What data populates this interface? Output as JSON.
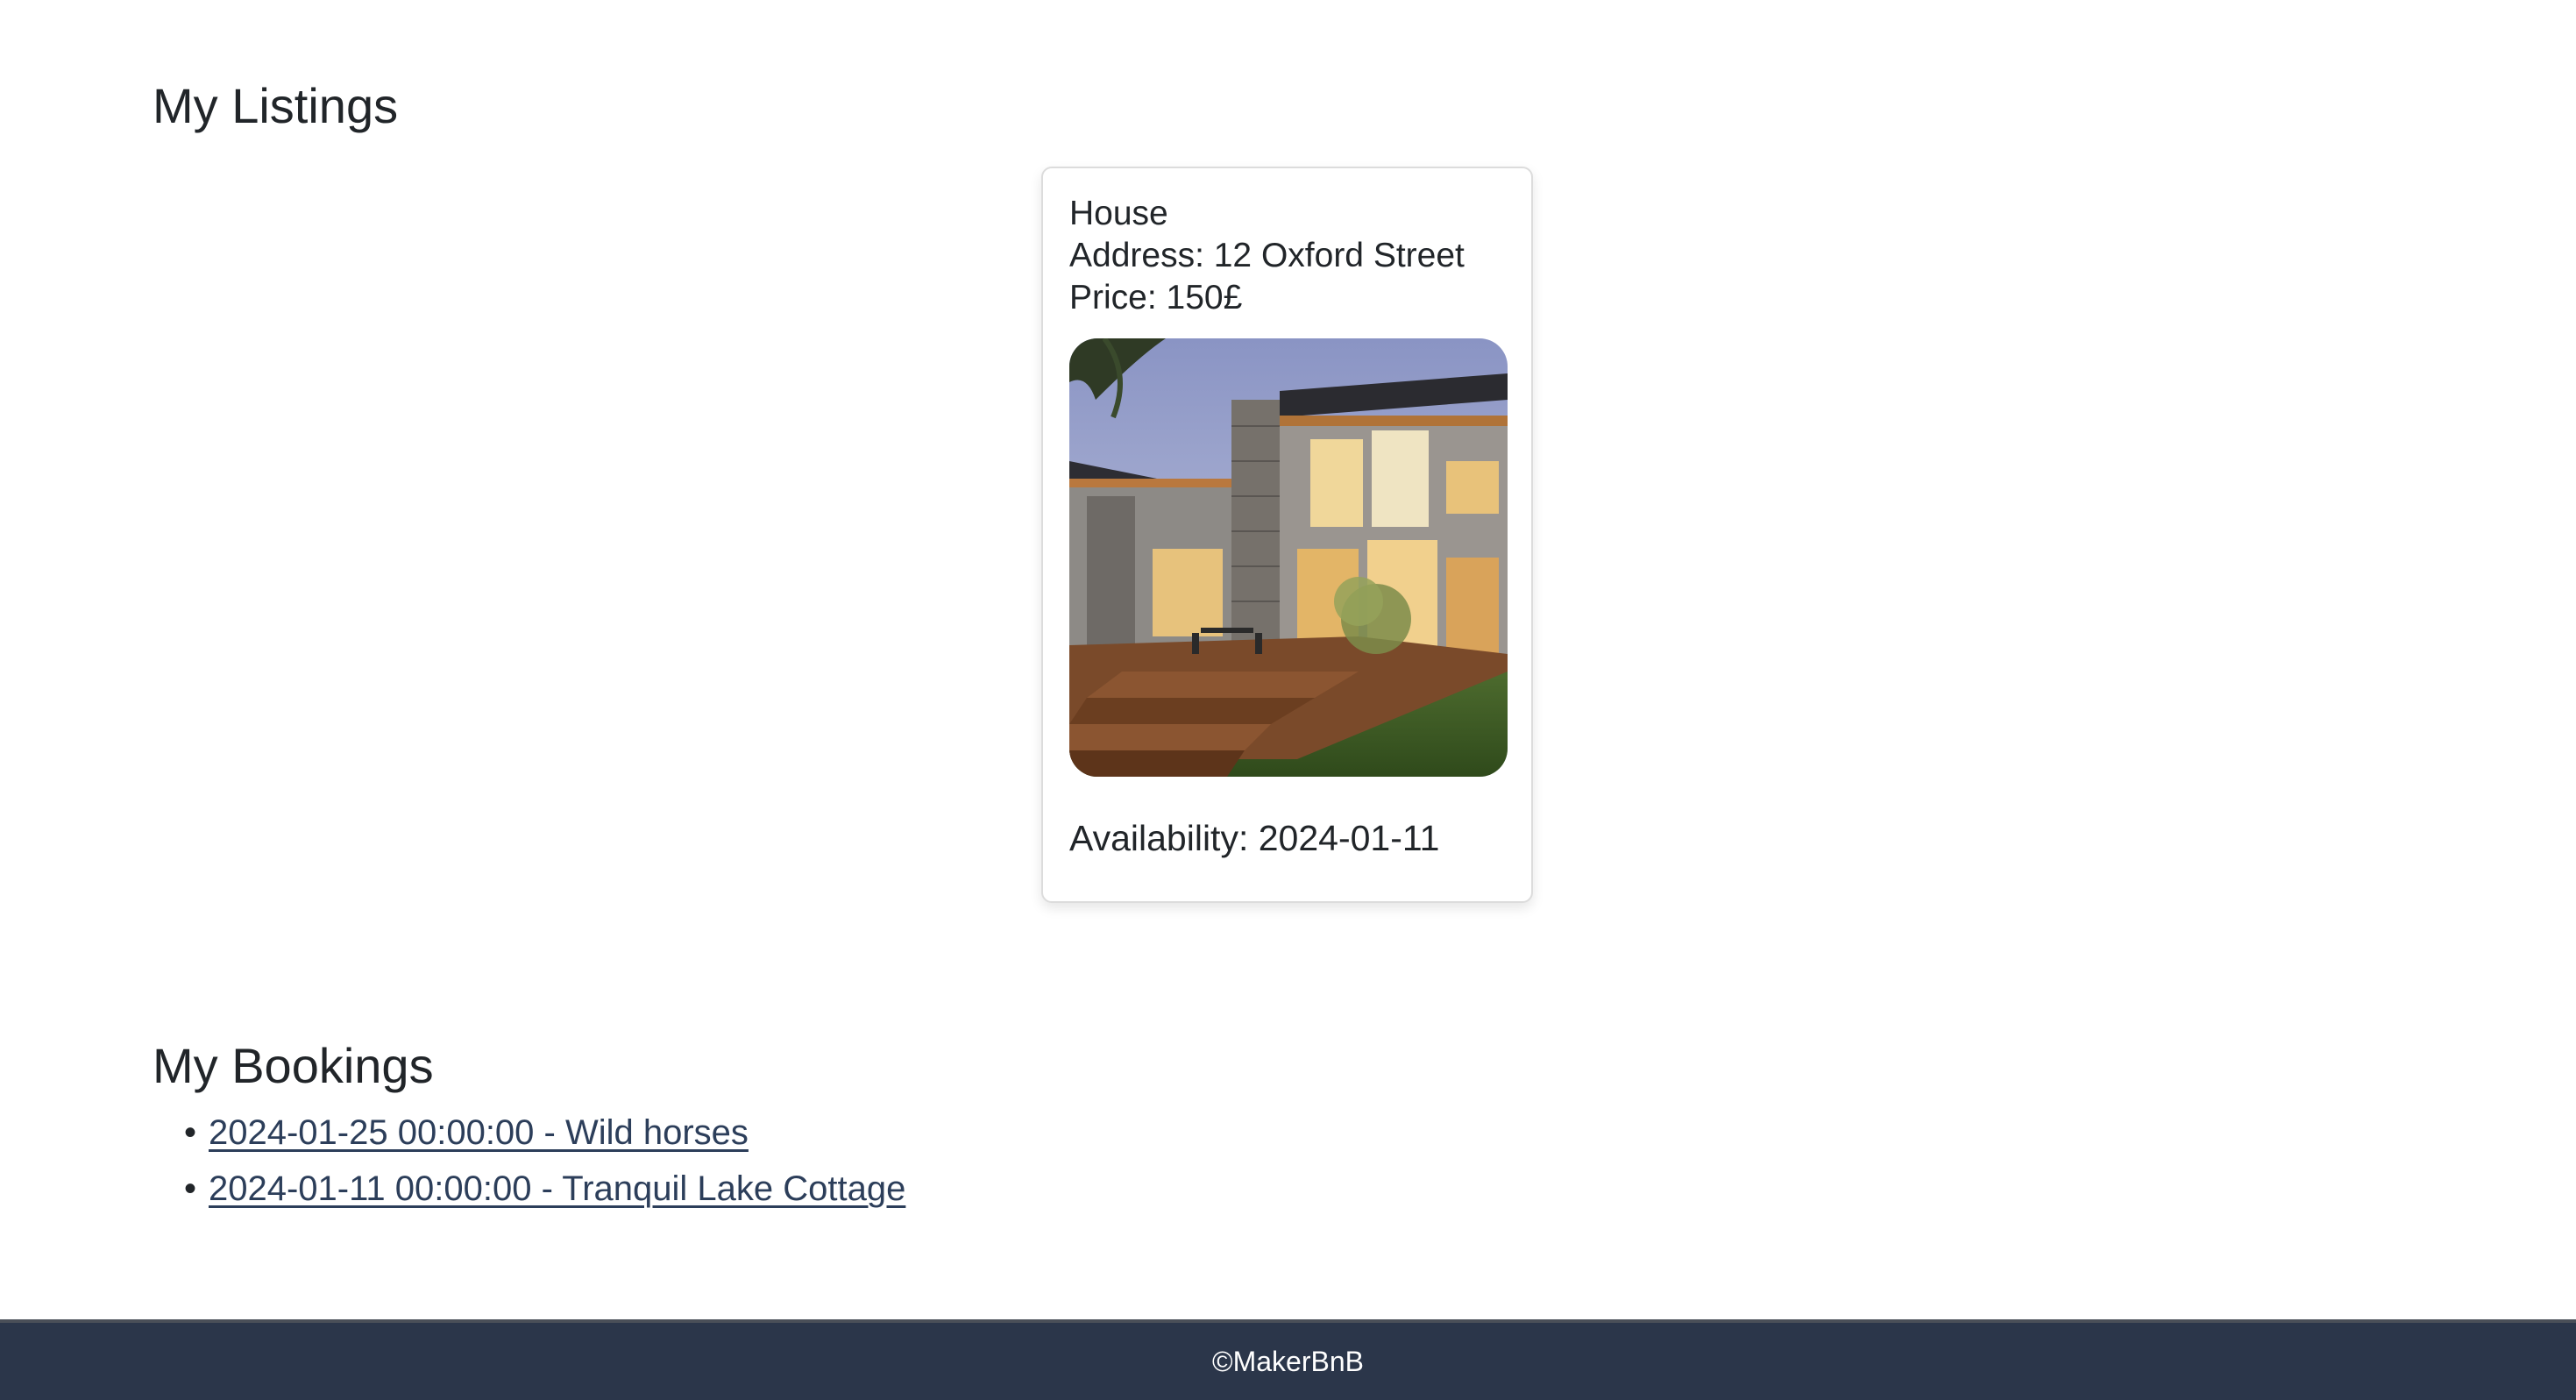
{
  "listings": {
    "title": "My Listings",
    "cards": [
      {
        "name": "House",
        "address": "Address: 12 Oxford Street",
        "price": "Price: 150£",
        "image_alt": "house-photo",
        "availability": "Availability: 2024-01-11"
      }
    ]
  },
  "bookings": {
    "title": "My Bookings",
    "items": [
      {
        "label": "2024-01-25 00:00:00 - Wild horses"
      },
      {
        "label": "2024-01-11 00:00:00 - Tranquil Lake Cottage"
      }
    ]
  },
  "footer": {
    "text": "©MakerBnB"
  },
  "colors": {
    "footer_bg": "#2b364a",
    "link": "#2c3e5a",
    "text": "#212529"
  }
}
